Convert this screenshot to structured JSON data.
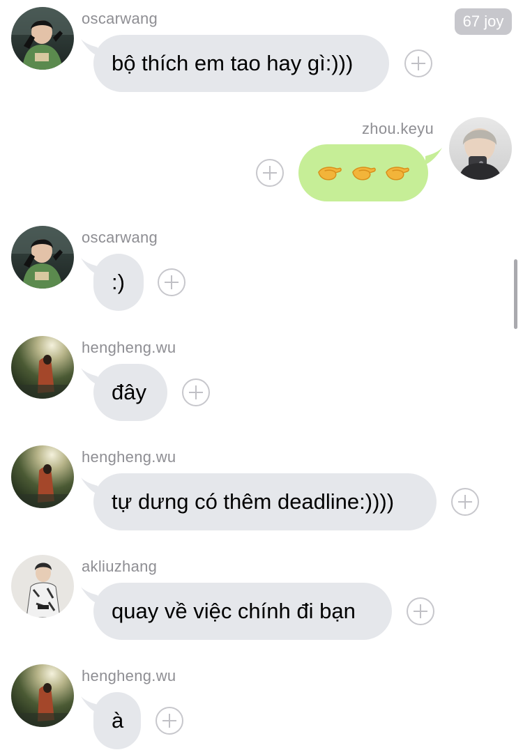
{
  "header": {
    "badge": "67 joy"
  },
  "colors": {
    "incoming_bubble": "#e5e7eb",
    "outgoing_bubble": "#c6ee97",
    "username": "#8e8e93",
    "badge_bg": "#c7c7cc"
  },
  "messages": [
    {
      "sender": "oscarwang",
      "text": "bộ thích em tao hay gì:)))",
      "direction": "incoming",
      "avatar": "oscarwang-avatar"
    },
    {
      "sender": "zhou.keyu",
      "text": "",
      "direction": "outgoing",
      "avatar": "zhou-keyu-avatar",
      "emoji": [
        "pinching-hand-emoji",
        "pinching-hand-emoji",
        "pinching-hand-emoji"
      ]
    },
    {
      "sender": "oscarwang",
      "text": ":)",
      "direction": "incoming",
      "avatar": "oscarwang-avatar"
    },
    {
      "sender": "hengheng.wu",
      "text": "đây",
      "direction": "incoming",
      "avatar": "hengheng-wu-avatar"
    },
    {
      "sender": "hengheng.wu",
      "text": "tự dưng có thêm deadline:))))",
      "direction": "incoming",
      "avatar": "hengheng-wu-avatar"
    },
    {
      "sender": "akliuzhang",
      "text": "quay về việc chính đi bạn",
      "direction": "incoming",
      "avatar": "akliuzhang-avatar"
    },
    {
      "sender": "hengheng.wu",
      "text": "à",
      "direction": "incoming",
      "avatar": "hengheng-wu-avatar"
    }
  ]
}
